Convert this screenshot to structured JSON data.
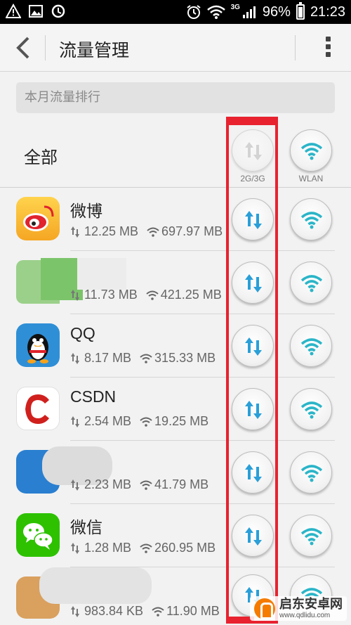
{
  "status_bar": {
    "network_type": "3G",
    "battery": "96%",
    "time": "21:23",
    "icons": [
      "warning-icon",
      "gallery-icon",
      "sync-icon",
      "alarm-icon",
      "wifi-icon",
      "signal-icon",
      "battery-icon"
    ]
  },
  "header": {
    "title": "流量管理",
    "back_icon": "back-arrow-icon",
    "more_icon": "overflow-menu-icon"
  },
  "section_title": "本月流量排行",
  "all_row": {
    "label": "全部",
    "col_mobile": "2G/3G",
    "col_wlan": "WLAN"
  },
  "apps": [
    {
      "name": "微博",
      "mobile": "12.25 MB",
      "wifi": "697.97 MB"
    },
    {
      "name": "",
      "mobile": "11.73 MB",
      "wifi": "421.25 MB"
    },
    {
      "name": "QQ",
      "mobile": "8.17 MB",
      "wifi": "315.33 MB"
    },
    {
      "name": "CSDN",
      "mobile": "2.54 MB",
      "wifi": "19.25 MB"
    },
    {
      "name": "",
      "mobile": "2.23 MB",
      "wifi": "41.79 MB"
    },
    {
      "name": "微信",
      "mobile": "1.28 MB",
      "wifi": "260.95 MB"
    },
    {
      "name": "",
      "mobile": "983.84 KB",
      "wifi": "11.90 MB"
    }
  ],
  "colors": {
    "accent_blue": "#2a9fd8",
    "wifi_teal": "#2bb5c8",
    "highlight_red": "#e8222f"
  },
  "watermark": {
    "title": "启东安卓网",
    "url": "www.qdlidu.com"
  }
}
